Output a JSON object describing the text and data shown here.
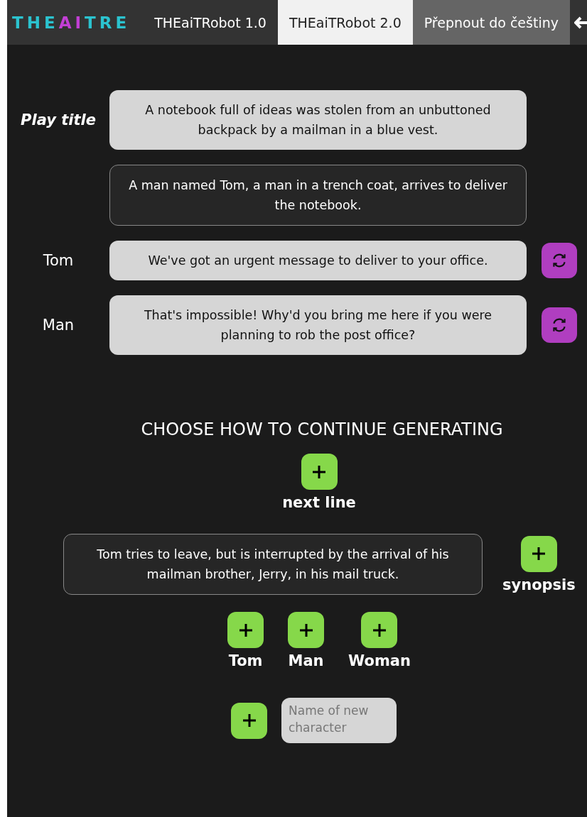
{
  "logo": [
    {
      "text": "THE",
      "color": "#2bc3cf"
    },
    {
      "text": "AI",
      "color": "#c23fd4"
    },
    {
      "text": "TRE",
      "color": "#2bc3cf"
    }
  ],
  "tabs": [
    {
      "label": "THEaiTRobot 1.0",
      "selected": false,
      "kind": "version"
    },
    {
      "label": "THEaiTRobot 2.0",
      "selected": true,
      "kind": "version"
    },
    {
      "label": "Přepnout do češtiny",
      "selected": false,
      "kind": "language"
    }
  ],
  "script": [
    {
      "kind": "title",
      "label": "Play title",
      "text": "A notebook full of ideas was stolen from an unbuttoned backpack by a mailman in a blue vest."
    },
    {
      "kind": "synopsis",
      "text": "A man named Tom, a man in a trench coat, arrives to deliver the notebook."
    },
    {
      "kind": "line",
      "label": "Tom",
      "text": "We've got an urgent message to deliver to your office."
    },
    {
      "kind": "line",
      "label": "Man",
      "text": "That's impossible! Why'd you bring me here if you were planning to rob the post office?"
    }
  ],
  "continue": {
    "heading": "CHOOSE HOW TO CONTINUE GENERATING",
    "next_line": "next line",
    "synopsis_text": "Tom tries to leave, but is interrupted by the arrival of his mailman brother, Jerry, in his mail truck.",
    "synopsis_label": "synopsis",
    "characters": [
      "Tom",
      "Man",
      "Woman"
    ],
    "new_character": {
      "placeholder": "Name of new character"
    }
  }
}
